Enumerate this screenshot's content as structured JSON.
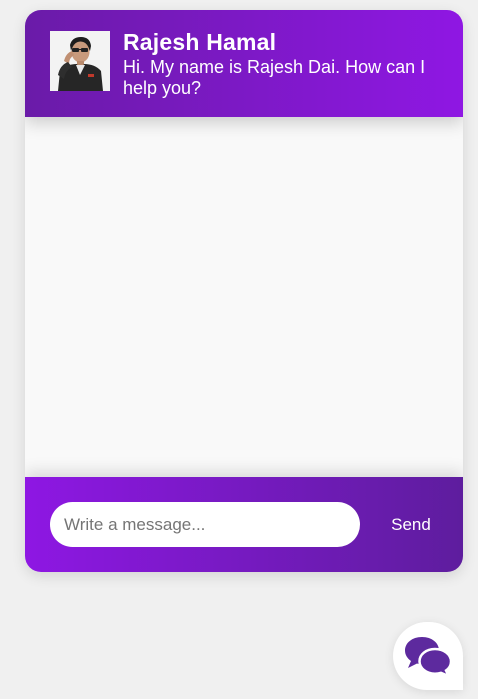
{
  "header": {
    "name": "Rajesh Hamal",
    "greeting": "Hi. My name is Rajesh Dai. How can I help you?",
    "avatar_icon": "person-photo"
  },
  "composer": {
    "placeholder": "Write a message...",
    "value": "",
    "send_label": "Send"
  },
  "launcher": {
    "icon": "chat-bubbles-icon"
  },
  "colors": {
    "header_gradient_start": "#6a1ba8",
    "header_gradient_end": "#8f17e3",
    "footer_gradient_start": "#8e17e3",
    "footer_gradient_end": "#5e1d9e",
    "launcher_icon": "#5d2a9e",
    "messages_bg": "#f9f9f9",
    "page_bg": "#f0f0f0"
  }
}
